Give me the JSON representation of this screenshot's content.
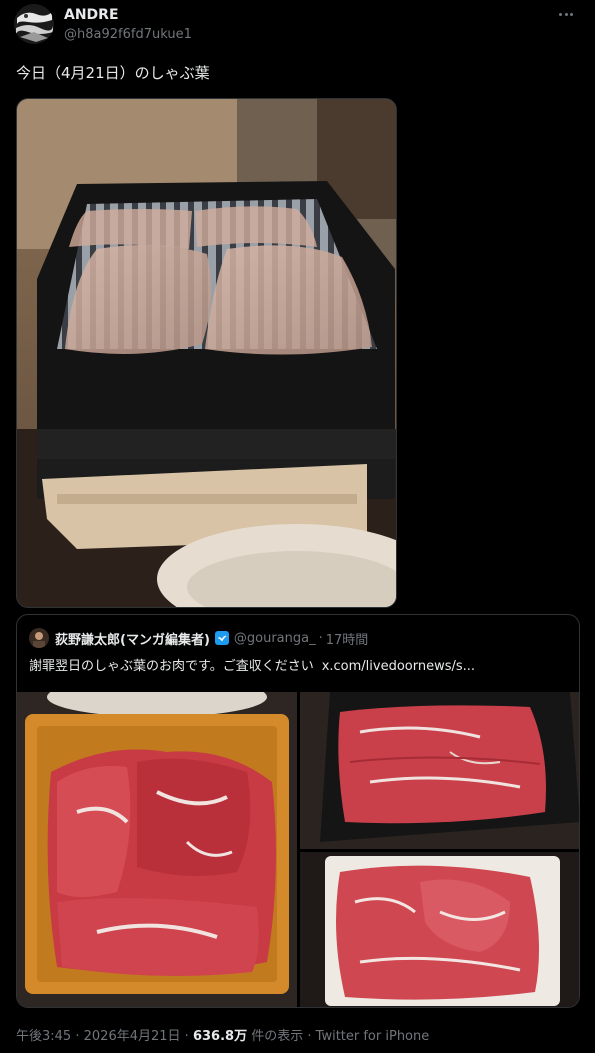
{
  "author": {
    "display_name": "ANDRE",
    "handle": "@h8a92f6fd7ukue1",
    "avatar_icon": "avatar-image"
  },
  "more_icon": "more-horizontal-icon",
  "tweet": {
    "text": "今日（4月21日）のしゃぶ葉"
  },
  "main_photo": {
    "description_icon": "photo-sliced-pork-in-black-tray"
  },
  "quote": {
    "author_name": "荻野謙太郎(マンガ編集者)",
    "verified_icon": "verified-badge-icon",
    "handle": "@gouranga_",
    "separator": "·",
    "time": "17時間",
    "text": "謝罪翌日のしゃぶ葉のお肉です。ご査収ください",
    "link": "x.com/livedoornews/s..."
  },
  "footer": {
    "time": "午後3:45",
    "sep1": "·",
    "date": "2026年4月21日",
    "sep2": "·",
    "views_count": "636.8万",
    "views_label": "件の表示",
    "sep3": "·",
    "source": "Twitter for iPhone"
  },
  "colors": {
    "background": "#000000",
    "text_primary": "#e7e9ea",
    "text_secondary": "#71767b",
    "border": "#2f3336",
    "verified": "#1d9bf0"
  }
}
